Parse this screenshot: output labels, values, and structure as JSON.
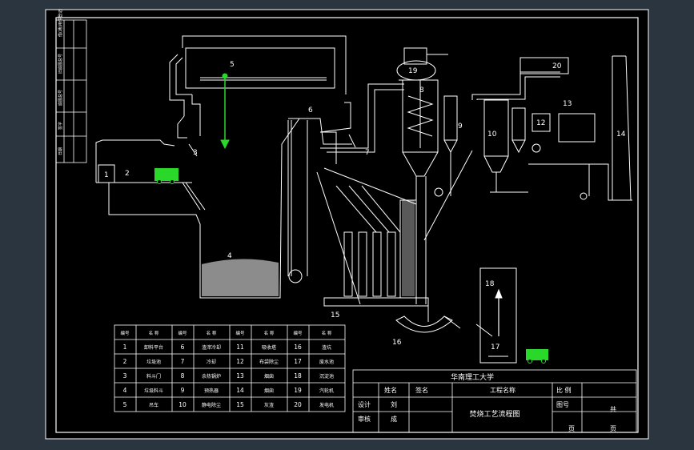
{
  "colors": {
    "viewport_bg": "#2b3540",
    "sheet_bg": "#000000",
    "line": "#ffffff",
    "crane": "#2ad82a",
    "truck": "#2ad82a"
  },
  "side_strip": {
    "labels": [
      "借(通)用件登记",
      "旧底图总号",
      "底图总号",
      "签字",
      "日期"
    ]
  },
  "equipment_labels": {
    "n1": "1",
    "n2": "2",
    "n3": "3",
    "n4": "4",
    "n5": "5",
    "n6": "6",
    "n7": "7",
    "n8": "8",
    "n9": "9",
    "n10": "10",
    "n12": "12",
    "n13": "13",
    "n14": "14",
    "n15": "15",
    "n16": "16",
    "n17": "17",
    "n18": "18",
    "n19": "19",
    "n20": "20"
  },
  "legend_table": {
    "header": [
      "编号",
      "名 称",
      "编号",
      "名 称",
      "编号",
      "名 称",
      "编号",
      "名 称"
    ],
    "rows": [
      [
        "1",
        "卸料平台",
        "6",
        "渣滓冷却",
        "11",
        "吸收塔",
        "16",
        "渣坑"
      ],
      [
        "2",
        "垃圾池",
        "7",
        "冷却",
        "12",
        "布袋除尘",
        "17",
        "废水池"
      ],
      [
        "3",
        "料斗门",
        "8",
        "余热锅炉",
        "13",
        "烟囱",
        "18",
        "沉淀池"
      ],
      [
        "4",
        "垃圾料斗",
        "9",
        "预热器",
        "14",
        "烟囱",
        "19",
        "汽轮机"
      ],
      [
        "5",
        "吊车",
        "10",
        "静电除尘",
        "15",
        "灰渣",
        "20",
        "发电机"
      ]
    ]
  },
  "title_block": {
    "school": "华南理工大学",
    "name_header": "姓名",
    "sign_header": "签名",
    "project_label": "工程名称",
    "scale_label": "比 例",
    "drawing_no_label": "图号",
    "designer_label": "设计",
    "designer_name": "刘",
    "reviewer_label": "审核",
    "reviewer_name": "成",
    "drawing_title": "焚烧工艺流程图",
    "sheet_total": "共",
    "sheet_unit1": "页",
    "sheet_unit2": "页"
  }
}
